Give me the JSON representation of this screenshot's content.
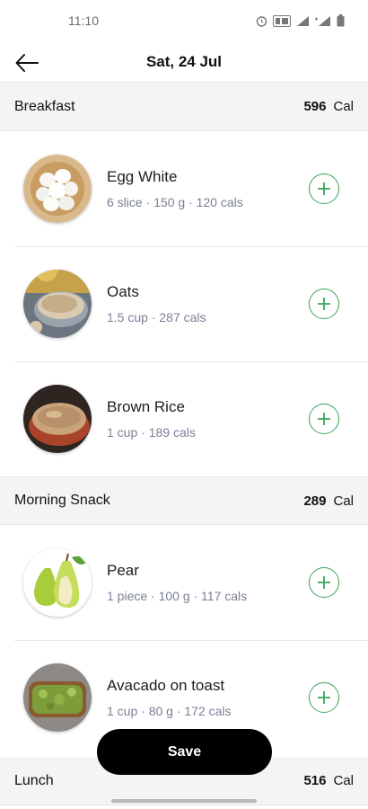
{
  "status_bar": {
    "time": "11:10"
  },
  "app_bar": {
    "title": "Sat, 24 Jul"
  },
  "sections": [
    {
      "name": "Breakfast",
      "calories": "596",
      "unit": "Cal",
      "items": [
        {
          "name": " Egg White",
          "meta": "6 slice · 150 g · 120 cals",
          "image": "egg-white"
        },
        {
          "name": "Oats",
          "meta": "1.5 cup · 287 cals",
          "image": "oats"
        },
        {
          "name": "Brown Rice",
          "meta": "1 cup · 189 cals",
          "image": "brown-rice"
        }
      ]
    },
    {
      "name": "Morning Snack",
      "calories": "289",
      "unit": "Cal",
      "items": [
        {
          "name": "Pear",
          "meta": "1 piece · 100 g · 117 cals",
          "image": "pear"
        },
        {
          "name": "Avacado on toast",
          "meta": "1 cup · 80 g · 172 cals",
          "image": "avocado-toast"
        }
      ]
    },
    {
      "name": "Lunch",
      "calories": "516",
      "unit": "Cal",
      "items": []
    }
  ],
  "save_button": {
    "label": "Save"
  },
  "colors": {
    "accent_green": "#3aa558",
    "section_bg": "#f4f4f4",
    "meta_text": "#7a7f95"
  }
}
